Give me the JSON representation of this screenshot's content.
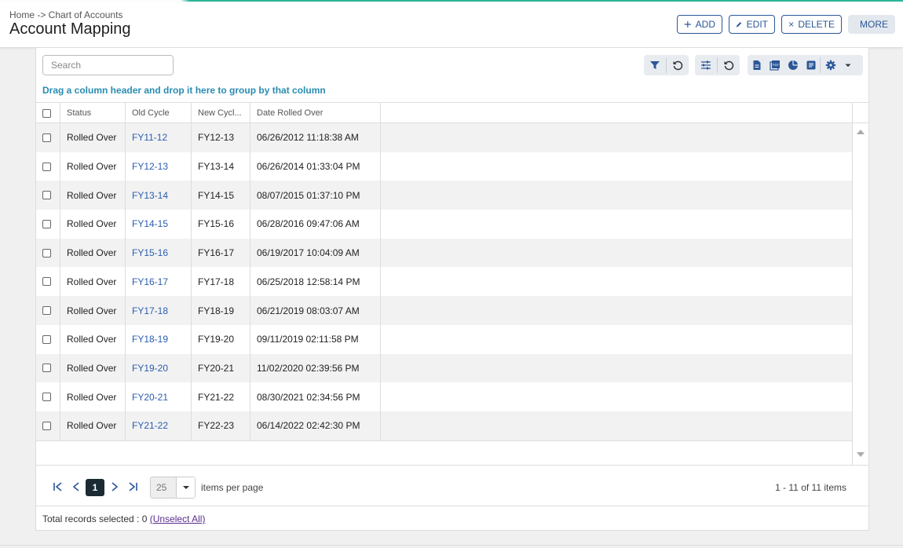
{
  "header": {
    "breadcrumb": "Home -> Chart of Accounts",
    "title": "Account Mapping",
    "buttons": {
      "add": "ADD",
      "edit": "EDIT",
      "delete": "DELETE",
      "more": "MORE"
    }
  },
  "toolbar": {
    "search_placeholder": "Search",
    "icons": [
      "filter-icon",
      "reset-filter-icon",
      "column-settings-icon",
      "reset-columns-icon",
      "export-doc-icon",
      "export-pdf-icon",
      "chart-icon",
      "report-icon",
      "gear-icon",
      "caret-down-icon"
    ],
    "accent_color": "#2b5797"
  },
  "group_hint": "Drag a column header and drop it here to group by that column",
  "grid": {
    "columns": [
      "Status",
      "Old Cycle",
      "New Cycl...",
      "Date Rolled Over"
    ],
    "rows": [
      {
        "status": "Rolled Over",
        "old_cycle": "FY11-12",
        "new_cycle": "FY12-13",
        "date": "06/26/2012 11:18:38 AM"
      },
      {
        "status": "Rolled Over",
        "old_cycle": "FY12-13",
        "new_cycle": "FY13-14",
        "date": "06/26/2014 01:33:04 PM"
      },
      {
        "status": "Rolled Over",
        "old_cycle": "FY13-14",
        "new_cycle": "FY14-15",
        "date": "08/07/2015 01:37:10 PM"
      },
      {
        "status": "Rolled Over",
        "old_cycle": "FY14-15",
        "new_cycle": "FY15-16",
        "date": "06/28/2016 09:47:06 AM"
      },
      {
        "status": "Rolled Over",
        "old_cycle": "FY15-16",
        "new_cycle": "FY16-17",
        "date": "06/19/2017 10:04:09 AM"
      },
      {
        "status": "Rolled Over",
        "old_cycle": "FY16-17",
        "new_cycle": "FY17-18",
        "date": "06/25/2018 12:58:14 PM"
      },
      {
        "status": "Rolled Over",
        "old_cycle": "FY17-18",
        "new_cycle": "FY18-19",
        "date": "06/21/2019 08:03:07 AM"
      },
      {
        "status": "Rolled Over",
        "old_cycle": "FY18-19",
        "new_cycle": "FY19-20",
        "date": "09/11/2019 02:11:58 PM"
      },
      {
        "status": "Rolled Over",
        "old_cycle": "FY19-20",
        "new_cycle": "FY20-21",
        "date": "11/02/2020 02:39:56 PM"
      },
      {
        "status": "Rolled Over",
        "old_cycle": "FY20-21",
        "new_cycle": "FY21-22",
        "date": "08/30/2021 02:34:56 PM"
      },
      {
        "status": "Rolled Over",
        "old_cycle": "FY21-22",
        "new_cycle": "FY22-23",
        "date": "06/14/2022 02:42:30 PM"
      }
    ]
  },
  "pager": {
    "current_page": "1",
    "per_page": "25",
    "per_page_label": "items per page",
    "info": "1 - 11 of 11 items"
  },
  "footer": {
    "selected_text": "Total records selected : 0",
    "unselect_label": "(Unselect All)"
  }
}
